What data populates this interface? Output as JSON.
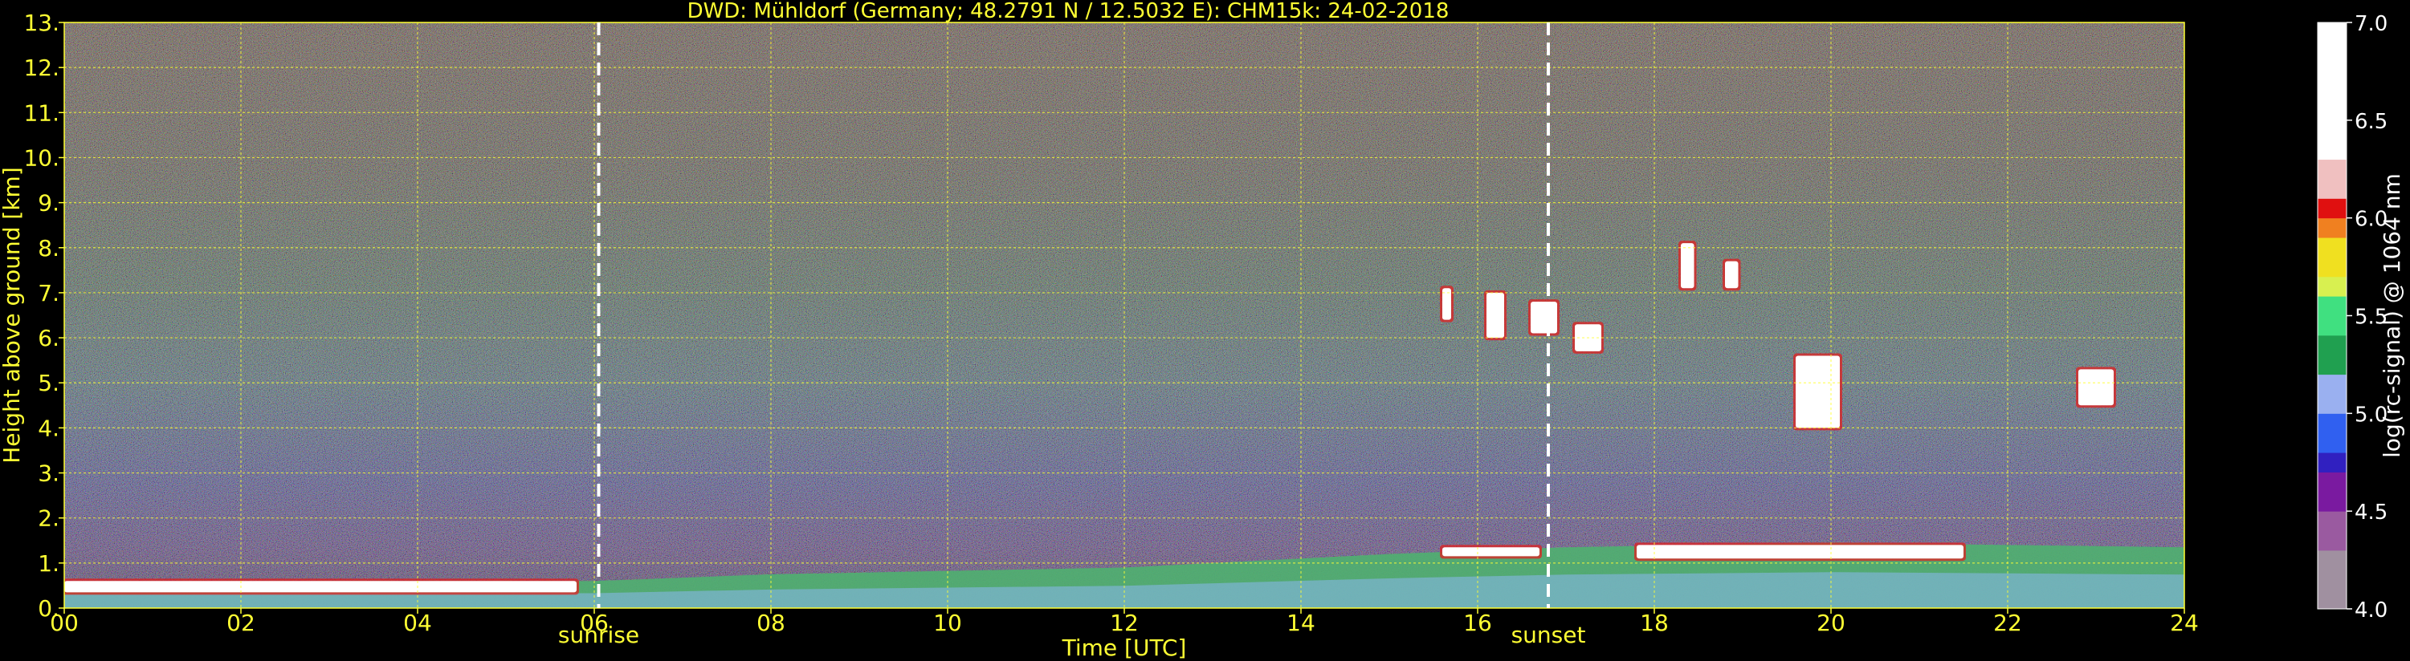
{
  "chart_data": {
    "type": "heatmap",
    "title": "DWD: Mühldorf (Germany; 48.2791 N / 12.5032 E):    CHM15k: 24-02-2018",
    "xlabel": "Time [UTC]",
    "ylabel": "Height above ground [km]",
    "xlim": [
      0,
      24
    ],
    "ylim": [
      0,
      13
    ],
    "x_ticks": [
      0,
      2,
      4,
      6,
      8,
      10,
      12,
      14,
      16,
      18,
      20,
      22,
      24
    ],
    "x_tick_labels": [
      "00",
      "02",
      "04",
      "06",
      "08",
      "10",
      "12",
      "14",
      "16",
      "18",
      "20",
      "22",
      "24"
    ],
    "y_ticks": [
      0,
      1,
      2,
      3,
      4,
      5,
      6,
      7,
      8,
      9,
      10,
      11,
      12,
      13
    ],
    "y_tick_labels": [
      "0.",
      "1.",
      "2.",
      "3.",
      "4.",
      "5.",
      "6.",
      "7.",
      "8.",
      "9.",
      "10.",
      "11.",
      "12.",
      "13."
    ],
    "grid": true,
    "colorbar": {
      "label": "log(rc-signal) @ 1064 nm",
      "range": [
        4.0,
        7.0
      ],
      "ticks": [
        4.0,
        4.5,
        5.0,
        5.5,
        6.0,
        6.5,
        7.0
      ],
      "tick_labels": [
        "4.0",
        "4.5",
        "5.0",
        "5.5",
        "6.0",
        "6.5",
        "7.0"
      ],
      "stops": [
        {
          "v": 4.0,
          "color": "#a090a0"
        },
        {
          "v": 4.3,
          "color": "#9a5aa0"
        },
        {
          "v": 4.5,
          "color": "#7a1aa0"
        },
        {
          "v": 4.65,
          "color": "#3020c0"
        },
        {
          "v": 4.8,
          "color": "#3060f0"
        },
        {
          "v": 5.0,
          "color": "#9ab0f0"
        },
        {
          "v": 5.2,
          "color": "#20a050"
        },
        {
          "v": 5.4,
          "color": "#40e080"
        },
        {
          "v": 5.55,
          "color": "#d8f050"
        },
        {
          "v": 5.7,
          "color": "#f0e020"
        },
        {
          "v": 5.85,
          "color": "#f08020"
        },
        {
          "v": 5.95,
          "color": "#e01010"
        },
        {
          "v": 6.05,
          "color": "#f0c0c0"
        },
        {
          "v": 6.25,
          "color": "#ffffff"
        },
        {
          "v": 7.0,
          "color": "#ffffff"
        }
      ]
    },
    "annotations": [
      {
        "type": "vline",
        "x": 6.05,
        "style": "dashed",
        "label": "sunrise"
      },
      {
        "type": "vline",
        "x": 16.8,
        "style": "dashed",
        "label": "sunset"
      }
    ],
    "features": {
      "boundary_layer": [
        {
          "t": 0.0,
          "top": 0.55
        },
        {
          "t": 3.0,
          "top": 0.6
        },
        {
          "t": 6.0,
          "top": 0.6
        },
        {
          "t": 8.0,
          "top": 0.75
        },
        {
          "t": 12.0,
          "top": 0.9
        },
        {
          "t": 15.0,
          "top": 1.2
        },
        {
          "t": 17.0,
          "top": 1.35
        },
        {
          "t": 20.0,
          "top": 1.45
        },
        {
          "t": 24.0,
          "top": 1.35
        }
      ],
      "clouds": [
        {
          "t0": 0.0,
          "t1": 5.8,
          "h0": 0.35,
          "h1": 0.6
        },
        {
          "t0": 15.6,
          "t1": 16.7,
          "h0": 1.15,
          "h1": 1.35
        },
        {
          "t0": 17.8,
          "t1": 21.5,
          "h0": 1.1,
          "h1": 1.4
        },
        {
          "t0": 15.6,
          "t1": 15.7,
          "h0": 6.4,
          "h1": 7.1
        },
        {
          "t0": 16.1,
          "t1": 16.3,
          "h0": 6.0,
          "h1": 7.0
        },
        {
          "t0": 16.6,
          "t1": 16.9,
          "h0": 6.1,
          "h1": 6.8
        },
        {
          "t0": 17.1,
          "t1": 17.4,
          "h0": 5.7,
          "h1": 6.3
        },
        {
          "t0": 18.3,
          "t1": 18.45,
          "h0": 7.1,
          "h1": 8.1
        },
        {
          "t0": 18.8,
          "t1": 18.95,
          "h0": 7.1,
          "h1": 7.7
        },
        {
          "t0": 19.6,
          "t1": 20.1,
          "h0": 4.0,
          "h1": 5.6
        },
        {
          "t0": 22.8,
          "t1": 23.2,
          "h0": 4.5,
          "h1": 5.3
        }
      ]
    }
  }
}
